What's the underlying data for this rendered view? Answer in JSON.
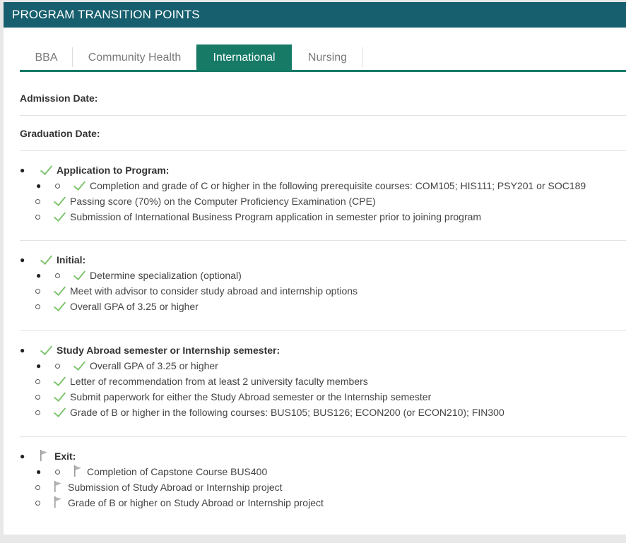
{
  "header": {
    "title": "PROGRAM TRANSITION POINTS"
  },
  "tabs": [
    {
      "label": "BBA"
    },
    {
      "label": "Community Health"
    },
    {
      "label": "International"
    },
    {
      "label": "Nursing"
    }
  ],
  "admission": {
    "label": "Admission Date:",
    "value": ""
  },
  "graduation": {
    "label": "Graduation Date:",
    "value": ""
  },
  "sections": [
    {
      "title": "Application to Program:",
      "status": "complete",
      "items": [
        "Completion and grade of C or higher in the following prerequisite courses: COM105; HIS111; PSY201 or SOC189",
        "Passing score (70%) on the Computer Proficiency Examination (CPE)",
        "Submission of International Business Program application in semester prior to joining program"
      ]
    },
    {
      "title": "Initial:",
      "status": "complete",
      "items": [
        "Determine specialization (optional)",
        "Meet with advisor to consider study abroad and internship options",
        "Overall GPA of 3.25 or higher"
      ]
    },
    {
      "title": "Study Abroad semester or Internship semester:",
      "status": "complete",
      "items": [
        "Overall GPA of 3.25 or higher",
        "Letter of recommendation from at least 2 university faculty members",
        "Submit paperwork for either the Study Abroad semester or the Internship semester",
        "Grade of B or higher in the following courses: BUS105; BUS126; ECON200 (or ECON210); FIN300"
      ]
    },
    {
      "title": "Exit:",
      "status": "pending",
      "items": [
        "Completion of Capstone Course BUS400",
        "Submission of Study Abroad or Internship project",
        "Grade of B or higher on Study Abroad or Internship project"
      ]
    }
  ],
  "icons": {
    "complete": "check-icon",
    "pending": "flag-icon"
  },
  "colors": {
    "header_bg": "#175f6e",
    "tab_active": "#167a67",
    "check": "#7ec46e",
    "flag": "#9a9a9a"
  }
}
